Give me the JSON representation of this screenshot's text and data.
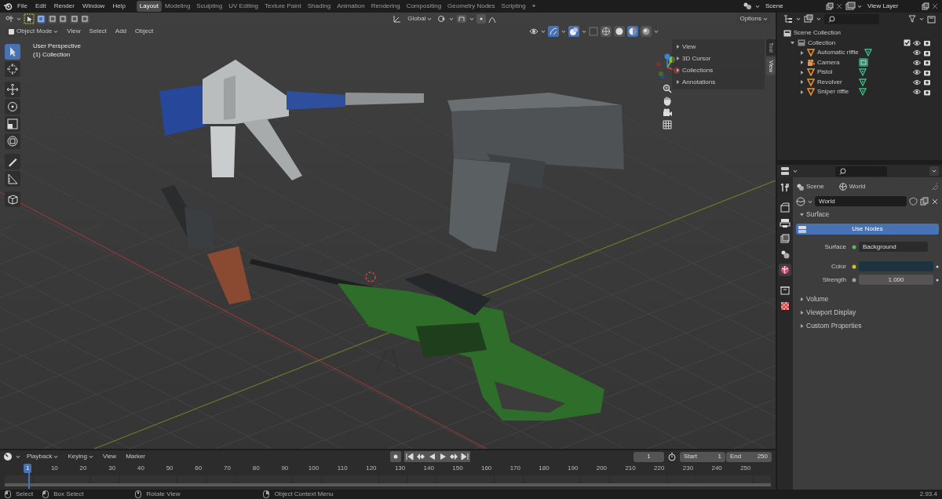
{
  "menu": [
    "File",
    "Edit",
    "Render",
    "Window",
    "Help"
  ],
  "workspaces": [
    {
      "label": "Layout",
      "selected": true
    },
    {
      "label": "Modeling",
      "selected": false
    },
    {
      "label": "Sculpting",
      "selected": false
    },
    {
      "label": "UV Editing",
      "selected": false
    },
    {
      "label": "Texture Paint",
      "selected": false
    },
    {
      "label": "Shading",
      "selected": false
    },
    {
      "label": "Animation",
      "selected": false
    },
    {
      "label": "Rendering",
      "selected": false
    },
    {
      "label": "Compositing",
      "selected": false
    },
    {
      "label": "Geometry Nodes",
      "selected": false
    },
    {
      "label": "Scripting",
      "selected": false
    }
  ],
  "add_workspace": "+",
  "scene": "Scene",
  "view_layer": "View Layer",
  "viewport": {
    "select_modes": [
      {
        "selected": true
      },
      {
        "selected": false
      },
      {
        "selected": false
      },
      {
        "selected": false
      },
      {
        "selected": false
      }
    ],
    "orientation": "Global",
    "options": "Options",
    "mode": "Object Mode",
    "menus": [
      "View",
      "Select",
      "Add",
      "Object"
    ],
    "shading": [
      {
        "kind": "wireframe",
        "selected": false
      },
      {
        "kind": "solid",
        "selected": false
      },
      {
        "kind": "material",
        "selected": true
      },
      {
        "kind": "rendered",
        "selected": false
      }
    ],
    "info": [
      "User Perspective",
      "(1) Collection"
    ],
    "tools": [
      {
        "kind": "select",
        "selected": true
      },
      {
        "kind": "cursor",
        "selected": false
      },
      {
        "kind": "move",
        "selected": false
      },
      {
        "kind": "rotate",
        "selected": false
      },
      {
        "kind": "scale",
        "selected": false
      },
      {
        "kind": "transform",
        "selected": false
      },
      {
        "kind": "annotate",
        "selected": false
      },
      {
        "kind": "measure",
        "selected": false
      },
      {
        "kind": "add-cube",
        "selected": false
      }
    ],
    "side_panels": [
      "View",
      "3D Cursor",
      "Collections",
      "Annotations"
    ],
    "side_tabs": [
      {
        "label": "Tool",
        "selected": false
      },
      {
        "label": "View",
        "selected": true
      }
    ]
  },
  "outliner": {
    "root": "Scene Collection",
    "collections": [
      {
        "label": "Collection",
        "expanded": true,
        "checked": true,
        "children": [
          {
            "label": "Automatic riffle",
            "kind": "mesh"
          },
          {
            "label": "Camera",
            "kind": "camera"
          },
          {
            "label": "Pistol",
            "kind": "mesh"
          },
          {
            "label": "Revolver",
            "kind": "mesh"
          },
          {
            "label": "Sniper riffle",
            "kind": "mesh"
          }
        ]
      }
    ]
  },
  "properties": {
    "tabs": [
      {
        "kind": "tool",
        "selected": false
      },
      {
        "kind": "render",
        "selected": false
      },
      {
        "kind": "output",
        "selected": false
      },
      {
        "kind": "view-layer",
        "selected": false
      },
      {
        "kind": "scene",
        "selected": false
      },
      {
        "kind": "world",
        "selected": true
      },
      {
        "kind": "collection",
        "selected": false
      },
      {
        "kind": "texture",
        "selected": false
      }
    ],
    "breadcrumb": [
      "Scene",
      "World"
    ],
    "world": "World",
    "panels": [
      {
        "label": "Surface",
        "expanded": true
      },
      {
        "label": "Volume",
        "expanded": false
      },
      {
        "label": "Viewport Display",
        "expanded": false
      },
      {
        "label": "Custom Properties",
        "expanded": false
      }
    ],
    "use_nodes": "Use Nodes",
    "fields": [
      {
        "kind": "link",
        "label": "Surface",
        "value": "Background"
      },
      {
        "kind": "color",
        "label": "Color",
        "color": "#1c3442"
      },
      {
        "kind": "number",
        "label": "Strength",
        "value": "1.000"
      }
    ]
  },
  "timeline": {
    "menus": [
      "Playback",
      "Keying",
      "View",
      "Marker"
    ],
    "current_frame": "1",
    "start_label": "Start",
    "start": "1",
    "end_label": "End",
    "end": "250",
    "playhead": "1",
    "ticks": [
      "10",
      "20",
      "30",
      "40",
      "50",
      "60",
      "70",
      "80",
      "90",
      "100",
      "110",
      "120",
      "130",
      "140",
      "150",
      "160",
      "170",
      "180",
      "190",
      "200",
      "210",
      "220",
      "230",
      "240",
      "250"
    ]
  },
  "status_bar": {
    "items": [
      "Select",
      "Box Select",
      "Rotate View",
      "Object Context Menu"
    ],
    "version": "2.93.4"
  }
}
